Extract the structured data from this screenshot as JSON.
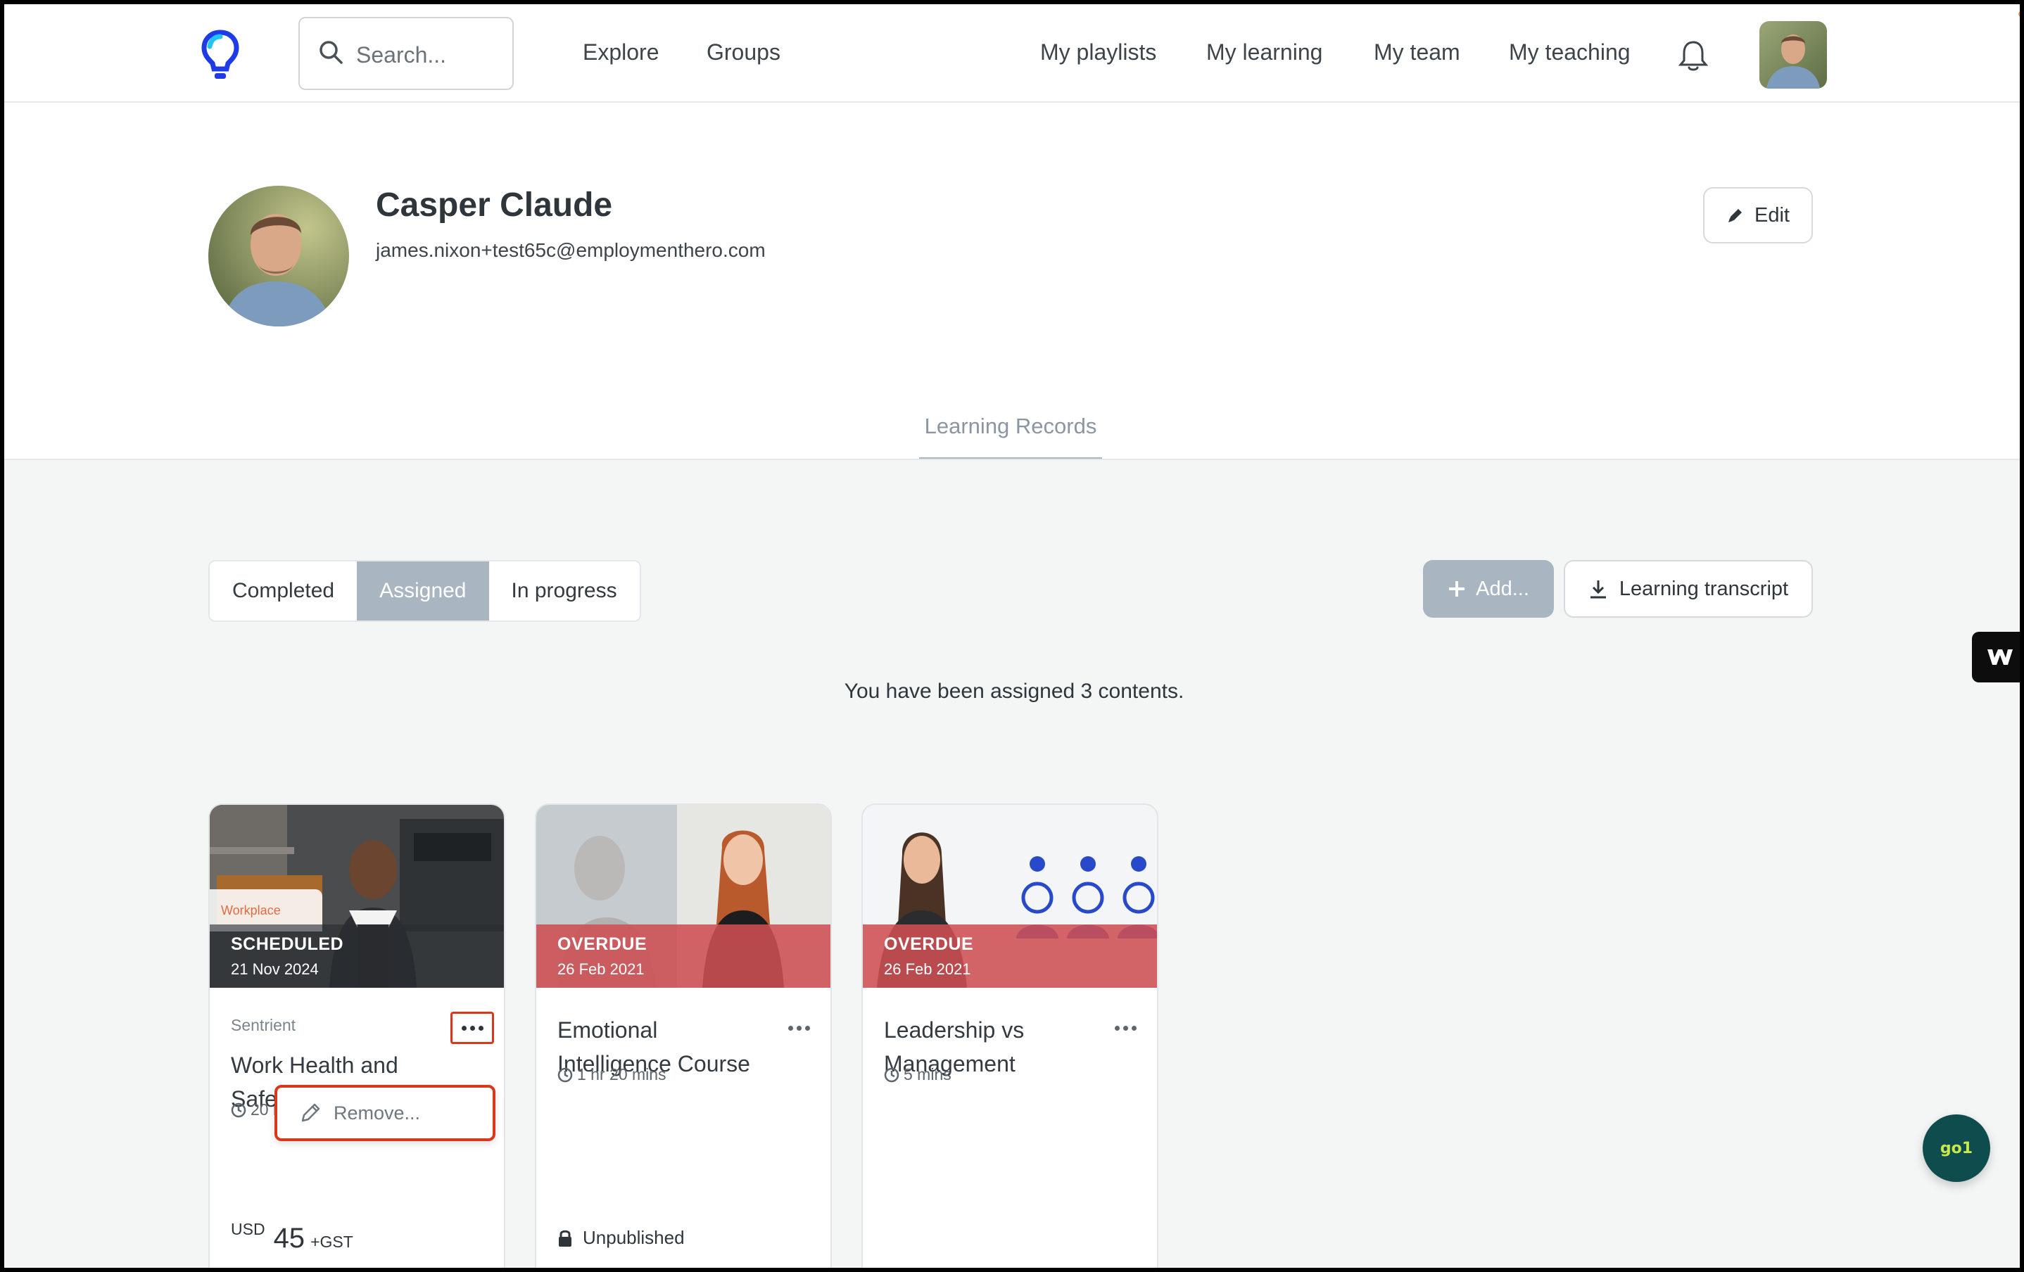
{
  "header": {
    "search_placeholder": "Search...",
    "nav_left": [
      "Explore",
      "Groups"
    ],
    "nav_right": [
      "My playlists",
      "My learning",
      "My team",
      "My teaching"
    ]
  },
  "profile": {
    "name": "Casper Claude",
    "email": "james.nixon+test65c@employmenthero.com",
    "edit_label": "Edit"
  },
  "tabs": {
    "learning_records": "Learning Records"
  },
  "filters": {
    "options": [
      "Completed",
      "Assigned",
      "In progress"
    ],
    "selected": "Assigned"
  },
  "actions": {
    "add_label": "Add...",
    "transcript_label": "Learning transcript"
  },
  "message": "You have been assigned 3 contents.",
  "cards": [
    {
      "status": "SCHEDULED",
      "date": "21 Nov 2024",
      "image_tag": "Workplace",
      "provider": "Sentrient",
      "title": "Work Health and Safety (Australia)",
      "duration": "20 mins",
      "price": {
        "currency": "USD",
        "amount": "45",
        "tax": "+GST"
      }
    },
    {
      "status": "OVERDUE",
      "date": "26 Feb 2021",
      "title": "Emotional Intelligence Course",
      "duration": "1 hr 20 mins",
      "footer": "Unpublished"
    },
    {
      "status": "OVERDUE",
      "date": "26 Feb 2021",
      "title": "Leadership vs Management",
      "duration": "5 mins"
    }
  ],
  "dropdown": {
    "remove_label": "Remove..."
  },
  "widgets": {
    "go1_label": "go1",
    "w_label": "W"
  },
  "colors": {
    "accent_slate": "#a9b6c1",
    "overdue_red": "#cd4e52",
    "highlight_red": "#d9391a",
    "go1_bg": "#0f4c4d",
    "logo_blue": "#1e3ce6",
    "logo_cyan": "#21c4f2"
  }
}
